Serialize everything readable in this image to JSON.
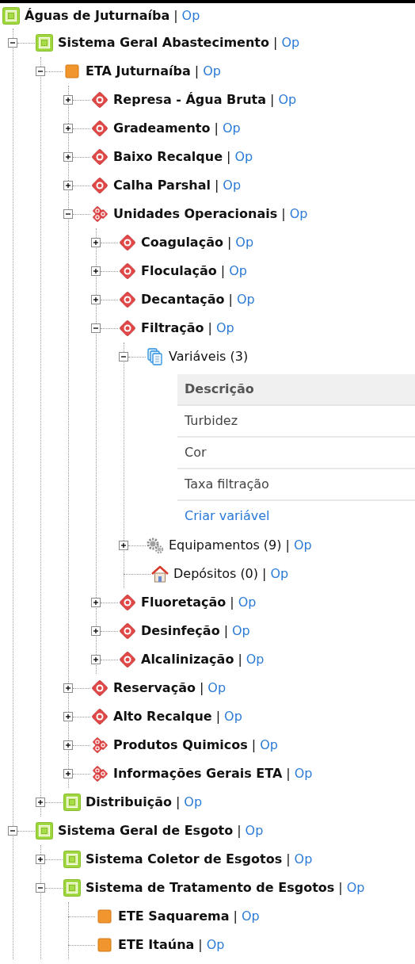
{
  "tree": {
    "kind": "system",
    "label": "Águas de Juturnaíba",
    "separator": "|",
    "link": "Op",
    "children": [
      {
        "kind": "system",
        "label": "Sistema Geral Abastecimento",
        "separator": "|",
        "link": "Op",
        "expanded": true,
        "children": [
          {
            "kind": "plant",
            "label": "ETA Juturnaíba",
            "separator": "|",
            "link": "Op",
            "expanded": true,
            "children": [
              {
                "kind": "unit",
                "label": "Represa - Água Bruta",
                "separator": "|",
                "link": "Op",
                "expanded": false
              },
              {
                "kind": "unit",
                "label": "Gradeamento",
                "separator": "|",
                "link": "Op",
                "expanded": false
              },
              {
                "kind": "unit",
                "label": "Baixo Recalque",
                "separator": "|",
                "link": "Op",
                "expanded": false
              },
              {
                "kind": "unit",
                "label": "Calha Parshal",
                "separator": "|",
                "link": "Op",
                "expanded": false
              },
              {
                "kind": "group",
                "label": "Unidades Operacionais",
                "separator": "|",
                "link": "Op",
                "expanded": true,
                "children": [
                  {
                    "kind": "unit",
                    "label": "Coagulação",
                    "separator": "|",
                    "link": "Op",
                    "expanded": false
                  },
                  {
                    "kind": "unit",
                    "label": "Floculação",
                    "separator": "|",
                    "link": "Op",
                    "expanded": false
                  },
                  {
                    "kind": "unit",
                    "label": "Decantação",
                    "separator": "|",
                    "link": "Op",
                    "expanded": false
                  },
                  {
                    "kind": "unit",
                    "label": "Filtração",
                    "separator": "|",
                    "link": "Op",
                    "expanded": true,
                    "children": [
                      {
                        "kind": "variables",
                        "label": "Variáveis (3)",
                        "expanded": true,
                        "table": {
                          "columns": [
                            "Descrição"
                          ],
                          "rows": [
                            "Turbidez",
                            "Cor",
                            "Taxa filtração"
                          ],
                          "link": "Criar variável"
                        }
                      },
                      {
                        "kind": "equipment",
                        "label": "Equipamentos (9)",
                        "separator": "|",
                        "link": "Op",
                        "expanded": false
                      },
                      {
                        "kind": "deposit",
                        "label": "Depósitos (0)",
                        "separator": "|",
                        "link": "Op"
                      }
                    ]
                  },
                  {
                    "kind": "unit",
                    "label": "Fluoretação",
                    "separator": "|",
                    "link": "Op",
                    "expanded": false
                  },
                  {
                    "kind": "unit",
                    "label": "Desinfeção",
                    "separator": "|",
                    "link": "Op",
                    "expanded": false
                  },
                  {
                    "kind": "unit",
                    "label": "Alcalinização",
                    "separator": "|",
                    "link": "Op",
                    "expanded": false
                  }
                ]
              },
              {
                "kind": "unit",
                "label": "Reservação",
                "separator": "|",
                "link": "Op",
                "expanded": false
              },
              {
                "kind": "unit",
                "label": "Alto Recalque",
                "separator": "|",
                "link": "Op",
                "expanded": false
              },
              {
                "kind": "group",
                "label": "Produtos Quimicos",
                "separator": "|",
                "link": "Op",
                "expanded": false
              },
              {
                "kind": "group",
                "label": "Informações Gerais ETA",
                "separator": "|",
                "link": "Op",
                "expanded": false
              }
            ]
          },
          {
            "kind": "system",
            "label": "Distribuição",
            "separator": "|",
            "link": "Op",
            "expanded": false
          }
        ]
      },
      {
        "kind": "system",
        "label": "Sistema Geral de Esgoto",
        "separator": "|",
        "link": "Op",
        "expanded": true,
        "children": [
          {
            "kind": "system",
            "label": "Sistema Coletor de Esgotos",
            "separator": "|",
            "link": "Op",
            "expanded": false
          },
          {
            "kind": "system",
            "label": "Sistema de Tratamento de Esgotos",
            "separator": "|",
            "link": "Op",
            "expanded": true,
            "children": [
              {
                "kind": "plant",
                "label": "ETE Saquarema",
                "separator": "|",
                "link": "Op"
              },
              {
                "kind": "plant",
                "label": "ETE Itaúna",
                "separator": "|",
                "link": "Op"
              }
            ]
          }
        ]
      }
    ]
  }
}
